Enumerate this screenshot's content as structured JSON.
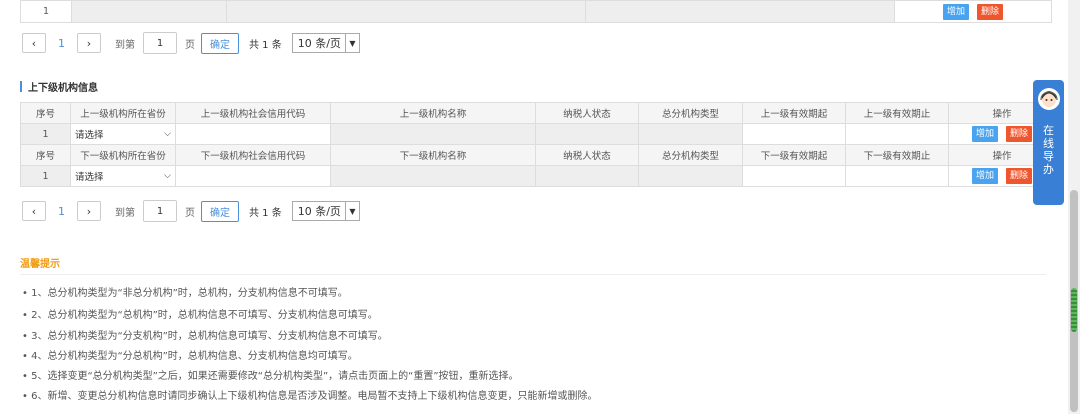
{
  "top_table": {
    "row_index": "1",
    "add_label": "增加",
    "delete_label": "删除"
  },
  "pager": {
    "prev_icon": "‹",
    "next_icon": "›",
    "current_page": "1",
    "goto_label": "到第",
    "page_input": "1",
    "page_unit": "页",
    "confirm_label": "确定",
    "total_label": "共 1 条",
    "page_size": "10 条/页"
  },
  "section": {
    "title": "上下级机构信息"
  },
  "upper_table": {
    "headers": [
      "序号",
      "上一级机构所在省份",
      "上一级机构社会信用代码",
      "上一级机构名称",
      "纳税人状态",
      "总分机构类型",
      "上一级有效期起",
      "上一级有效期止",
      "操作"
    ],
    "row": {
      "index": "1",
      "province_select": "请选择",
      "add_label": "增加",
      "delete_label": "删除"
    }
  },
  "lower_table": {
    "headers": [
      "序号",
      "下一级机构所在省份",
      "下一级机构社会信用代码",
      "下一级机构名称",
      "纳税人状态",
      "总分机构类型",
      "下一级有效期起",
      "下一级有效期止",
      "操作"
    ],
    "row": {
      "index": "1",
      "province_select": "请选择",
      "add_label": "增加",
      "delete_label": "删除"
    }
  },
  "tips": {
    "title": "温馨提示",
    "items": [
      "1、总分机构类型为“非总分机构”时，总机构，分支机构信息不可填写。",
      "2、总分机构类型为“总机构”时，总机构信息不可填写、分支机构信息可填写。",
      "3、总分机构类型为“分支机构”时，总机构信息可填写、分支机构信息不可填写。",
      "4、总分机构类型为“分总机构”时，总机构信息、分支机构信息均可填写。",
      "5、选择变更“总分机构类型”之后，如果还需要修改“总分机构类型”，请点击页面上的“重置”按钮，重新选择。",
      "6、新增、变更总分机构信息时请同步确认上下级机构信息是否涉及调整。电局暂不支持上下级机构信息变更，只能新增或删除。"
    ]
  },
  "online_guide": {
    "label_chars": [
      "在",
      "线",
      "导",
      "办"
    ]
  },
  "colors": {
    "accent": "#4a90d9",
    "add": "#4aa3ef",
    "delete": "#f0562d",
    "tip_title": "#f39c12"
  }
}
